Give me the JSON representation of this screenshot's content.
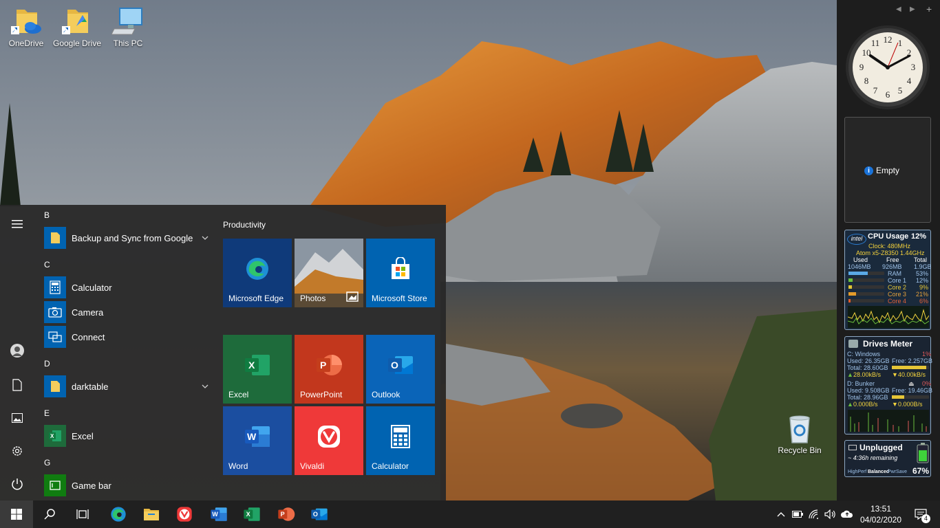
{
  "desktop": {
    "icons": [
      {
        "label": "OneDrive"
      },
      {
        "label": "Google Drive"
      },
      {
        "label": "This PC"
      },
      {
        "label": "Recycle Bin"
      }
    ]
  },
  "start_menu": {
    "apps": [
      {
        "letter": "B"
      },
      {
        "name": "Backup and Sync from Google",
        "icon": "folder-icon",
        "expandable": true
      },
      {
        "letter": "C"
      },
      {
        "name": "Calculator",
        "icon": "calculator-icon"
      },
      {
        "name": "Camera",
        "icon": "camera-icon"
      },
      {
        "name": "Connect",
        "icon": "connect-icon"
      },
      {
        "letter": "D"
      },
      {
        "name": "darktable",
        "icon": "folder-icon",
        "expandable": true
      },
      {
        "letter": "E"
      },
      {
        "name": "Excel",
        "icon": "excel-icon"
      },
      {
        "letter": "G"
      },
      {
        "name": "Game bar",
        "icon": "xbox-game-bar-icon"
      }
    ],
    "group_title": "Productivity",
    "tiles": [
      {
        "label": "Microsoft Edge",
        "icon": "edge-icon",
        "color": "#0f3a7a"
      },
      {
        "label": "Photos",
        "icon": "photos-icon",
        "color": "#7a8896"
      },
      {
        "label": "Microsoft Store",
        "icon": "store-icon",
        "color": "#0063b1"
      },
      {
        "label": "Excel",
        "icon": "excel-icon",
        "color": "#1e6b3b"
      },
      {
        "label": "PowerPoint",
        "icon": "powerpoint-icon",
        "color": "#c2371d"
      },
      {
        "label": "Outlook",
        "icon": "outlook-icon",
        "color": "#0a64b8"
      },
      {
        "label": "Word",
        "icon": "word-icon",
        "color": "#1b4ea0"
      },
      {
        "label": "Vivaldi",
        "icon": "vivaldi-icon",
        "color": "#ef3939"
      },
      {
        "label": "Calculator",
        "icon": "calculator-icon",
        "color": "#0063b1"
      }
    ]
  },
  "sidebar": {
    "empty_label": "Empty",
    "cpu": {
      "title": "CPU Usage",
      "percent": "12%",
      "brand": "intel",
      "clock": "Clock:  480MHz",
      "model": "Atom x5-Z8350 1.44GHz",
      "headers": [
        "Used",
        "Free",
        "Total"
      ],
      "mem_values": [
        "1046MB",
        "926MB",
        "1.9GB"
      ],
      "rows": [
        {
          "label": "RAM",
          "value": "53%",
          "fill": 0.53
        },
        {
          "label": "Core 1",
          "value": "12%",
          "fill": 0.12
        },
        {
          "label": "Core 2",
          "value": "9%",
          "fill": 0.09
        },
        {
          "label": "Core 3",
          "value": "21%",
          "fill": 0.21
        },
        {
          "label": "Core 4",
          "value": "6%",
          "fill": 0.06
        }
      ]
    },
    "drives": {
      "title": "Drives Meter",
      "c_name": "C: Windows",
      "c_pct": "1%",
      "c_used": "Used: 26.35GB",
      "c_free": "Free: 2.257GB",
      "c_total": "Total: 28.60GB",
      "c_read": "28.00kB/s",
      "c_write": "40.00kB/s",
      "d_name": "D: Bunker",
      "d_pct": "0%",
      "d_used": "Used: 9.508GB",
      "d_free": "Free: 19.46GB",
      "d_total": "Total: 28.96GB",
      "d_read": "0.000B/s",
      "d_write": "0.000B/s"
    },
    "battery": {
      "title": "Unplugged",
      "remaining": "~ 4:36h remaining",
      "modes": [
        "HighPerf",
        "Balanced",
        "PwrSave"
      ],
      "percent": "67%",
      "level": 0.67
    }
  },
  "taskbar": {
    "pinned": [
      "edge-icon",
      "file-explorer-icon",
      "vivaldi-icon",
      "word-icon",
      "excel-icon",
      "powerpoint-icon",
      "outlook-icon"
    ],
    "time": "13:51",
    "date": "04/02/2020",
    "notification_count": "4"
  }
}
